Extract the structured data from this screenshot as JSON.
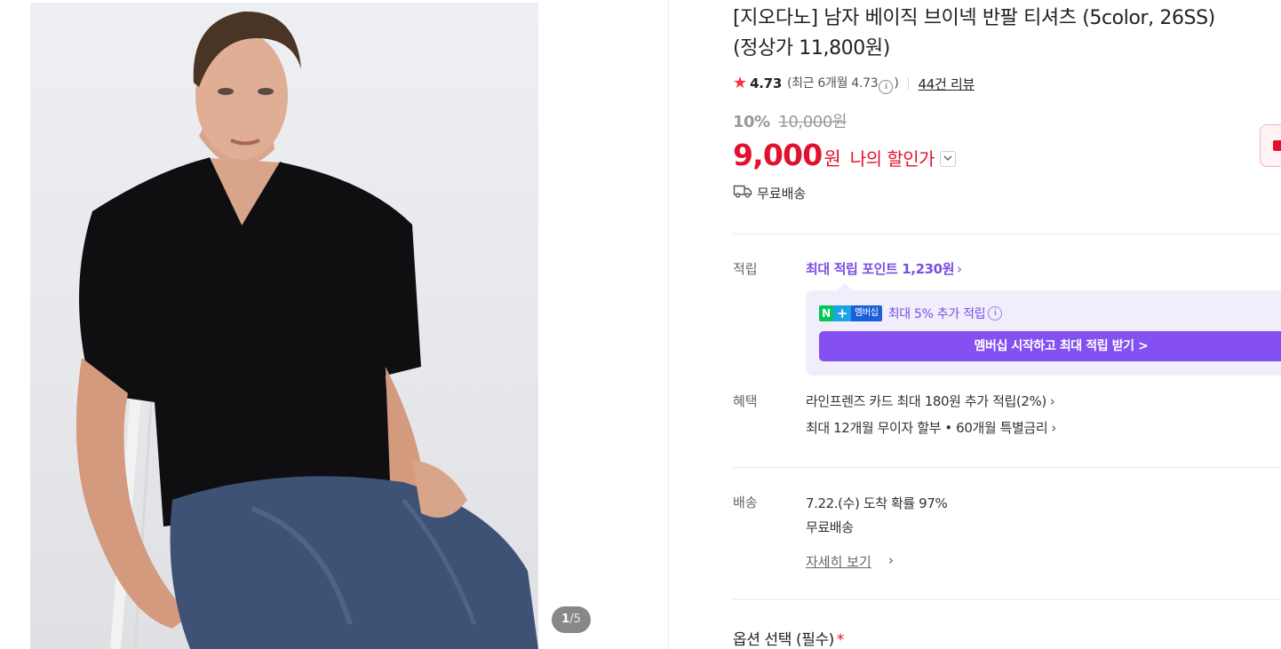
{
  "product": {
    "title_line1": "[지오다노] 남자 베이직 브이넥 반팔 티셔츠 (5color, 26SS)",
    "title_line2": "(정상가 11,800원)",
    "image_counter": {
      "current": "1",
      "separator": "/",
      "total": "5"
    }
  },
  "rating": {
    "score": "4.73",
    "recent_prefix": "(최근 6개월 4.73",
    "recent_suffix": ")",
    "reviews": "44건 리뷰"
  },
  "price": {
    "discount_rate": "10%",
    "original": "10,000원",
    "sale_value": "9,000",
    "sale_unit": "원",
    "my_discount": "나의 할인가"
  },
  "shipping": {
    "summary": "무료배송"
  },
  "points": {
    "label": "적립",
    "max_points": "최대 적립 포인트 1,230원",
    "membership_logo_n": "N",
    "membership_logo_plus": "+",
    "membership_logo_text": "멤버십",
    "membership_extra": "최대 5% 추가 적립",
    "membership_button": "멤버십 시작하고 최대 적립 받기 >"
  },
  "benefits": {
    "label": "혜택",
    "items": [
      "라인프렌즈 카드 최대 180원 추가 적립(2%)",
      "최대 12개월 무이자 할부 • 60개월 특별금리"
    ]
  },
  "delivery": {
    "label": "배송",
    "arrival": "7.22.(수) 도착 확률 97%",
    "fee": "무료배송",
    "detail_link": "자세히 보기"
  },
  "options": {
    "title": "옵션 선택 (필수)",
    "required_mark": "*"
  },
  "colors": {
    "accent_red": "#e1112e",
    "accent_purple": "#7a4ee0",
    "membership_button": "#8450f0",
    "membership_bg": "#f1eefc",
    "star": "#f5333f"
  },
  "icons": {
    "star": "star-icon",
    "info": "info-circle-icon",
    "chevron_down": "chevron-down-icon",
    "truck": "truck-icon",
    "chevron_right": "chevron-right-icon"
  }
}
